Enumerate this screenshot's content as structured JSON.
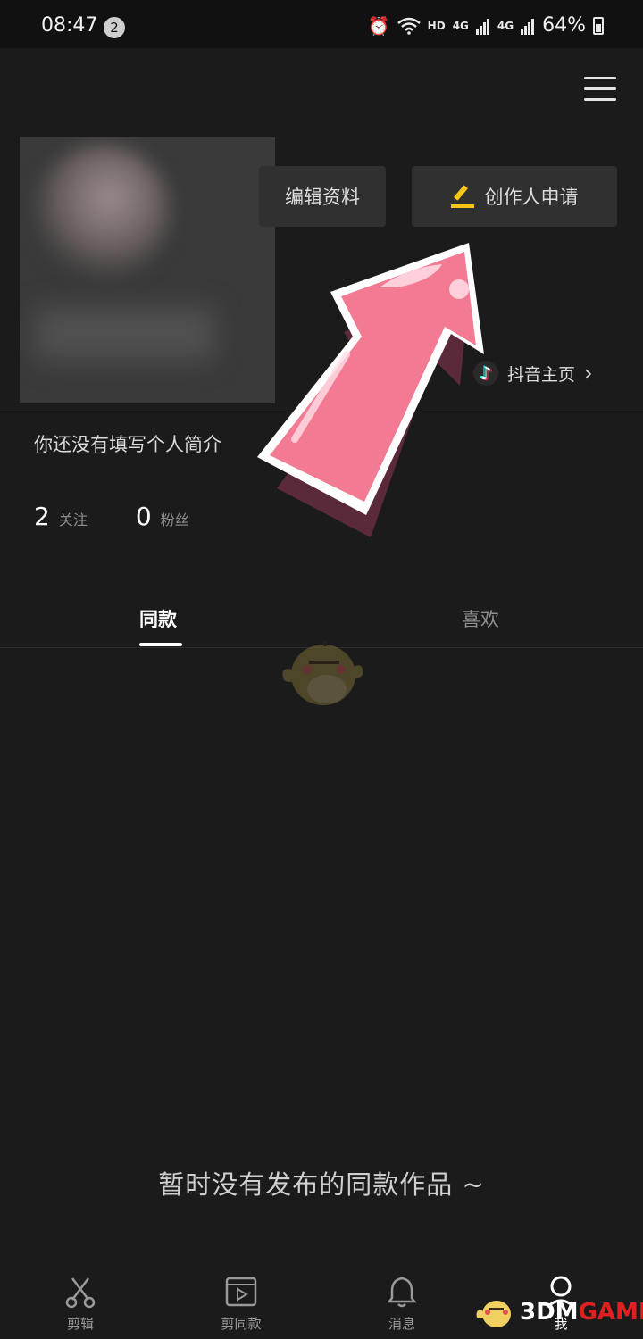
{
  "status_bar": {
    "time": "08:47",
    "notification_count": "2",
    "network_hd": "HD",
    "network_4g_1": "4G",
    "network_4g_2": "4G",
    "battery": "64%",
    "icons": [
      "alarm-icon",
      "wifi-icon",
      "signal-icon",
      "battery-icon"
    ]
  },
  "header": {
    "menu_icon": "menu-icon"
  },
  "profile": {
    "edit_button_label": "编辑资料",
    "creator_button_label": "创作人申请",
    "douyin_link_label": "抖音主页",
    "bio": "你还没有填写个人简介",
    "following_count": "2",
    "following_label": "关注",
    "followers_count": "0",
    "followers_label": "粉丝"
  },
  "tabs": [
    {
      "label": "同款",
      "active": true
    },
    {
      "label": "喜欢",
      "active": false
    }
  ],
  "empty_state": {
    "message": "暂时没有发布的同款作品 ~"
  },
  "bottom_nav": [
    {
      "label": "剪辑",
      "icon": "scissors-icon",
      "active": false
    },
    {
      "label": "剪同款",
      "icon": "video-play-icon",
      "active": false
    },
    {
      "label": "消息",
      "icon": "bell-icon",
      "active": false
    },
    {
      "label": "我",
      "icon": "profile-icon",
      "active": true
    }
  ],
  "watermark": {
    "prefix": "3DM",
    "suffix": "GAME"
  },
  "colors": {
    "background": "#1b1b1b",
    "button_bg": "#303030",
    "accent_yellow": "#f5c518",
    "arrow_pink": "#f27a92"
  }
}
